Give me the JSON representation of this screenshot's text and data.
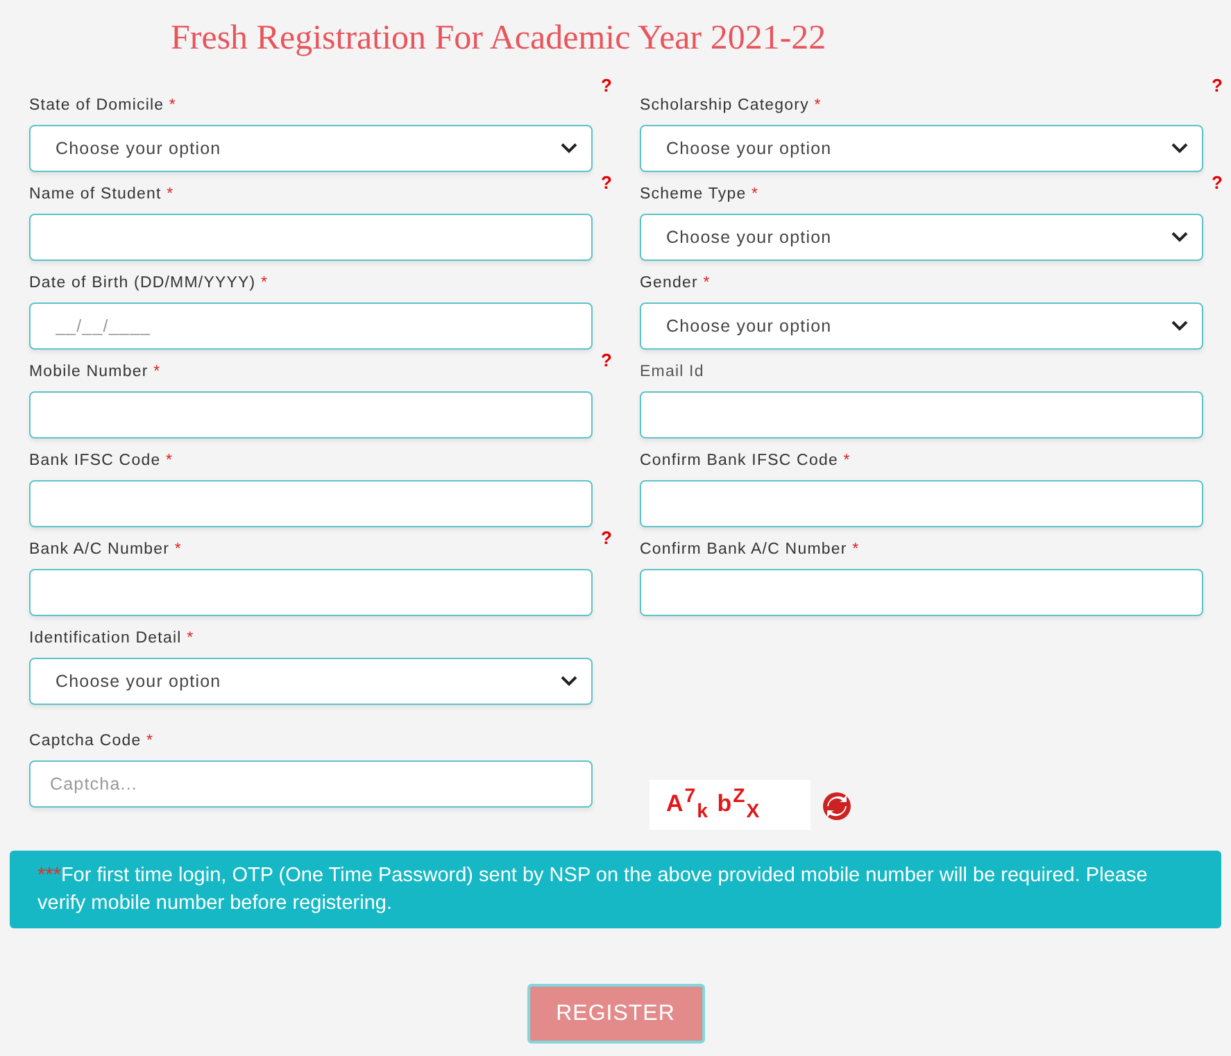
{
  "title": "Fresh Registration For Academic Year 2021-22",
  "rows": [
    {
      "left": {
        "label": "State of Domicile",
        "required": true,
        "kind": "select",
        "value": "Choose your option",
        "help_above": true,
        "help_below": true
      },
      "right": {
        "label": "Scholarship Category",
        "required": true,
        "kind": "select",
        "value": "Choose your option",
        "help_above": true,
        "help_below": true
      }
    },
    {
      "left": {
        "label": "Name of Student",
        "required": true,
        "kind": "input"
      },
      "right": {
        "label": "Scheme Type",
        "required": true,
        "kind": "select",
        "value": "Choose your option"
      }
    },
    {
      "left": {
        "label": "Date of Birth (DD/MM/YYYY)",
        "required": true,
        "kind": "input",
        "placeholder": "__/__/____",
        "help_below": true
      },
      "right": {
        "label": "Gender",
        "required": true,
        "kind": "select",
        "value": "Choose your option"
      }
    },
    {
      "left": {
        "label": "Mobile Number",
        "required": true,
        "kind": "input"
      },
      "right": {
        "label": "Email Id",
        "required": false,
        "kind": "input"
      }
    },
    {
      "left": {
        "label": "Bank IFSC Code",
        "required": true,
        "kind": "input",
        "help_below": true
      },
      "right": {
        "label": "Confirm Bank IFSC Code",
        "required": true,
        "kind": "input"
      }
    },
    {
      "left": {
        "label": "Bank A/C Number",
        "required": true,
        "kind": "input"
      },
      "right": {
        "label": "Confirm Bank A/C Number",
        "required": true,
        "kind": "input"
      }
    },
    {
      "left": {
        "label": "Identification Detail",
        "required": true,
        "kind": "select",
        "value": "Choose your option"
      }
    }
  ],
  "required_mark": "*",
  "help_mark": "?",
  "captcha": {
    "label": "Captcha Code",
    "required": true,
    "placeholder": "Captcha...",
    "image_text": "A$^{7}$$_{k}$ b$^{Z}$$_{X}$"
  },
  "notice": {
    "prefix": "***",
    "text": "For first time login, OTP (One Time Password) sent by NSP on the above provided mobile number will be required. Please verify mobile number before registering."
  },
  "register_button": "REGISTER"
}
